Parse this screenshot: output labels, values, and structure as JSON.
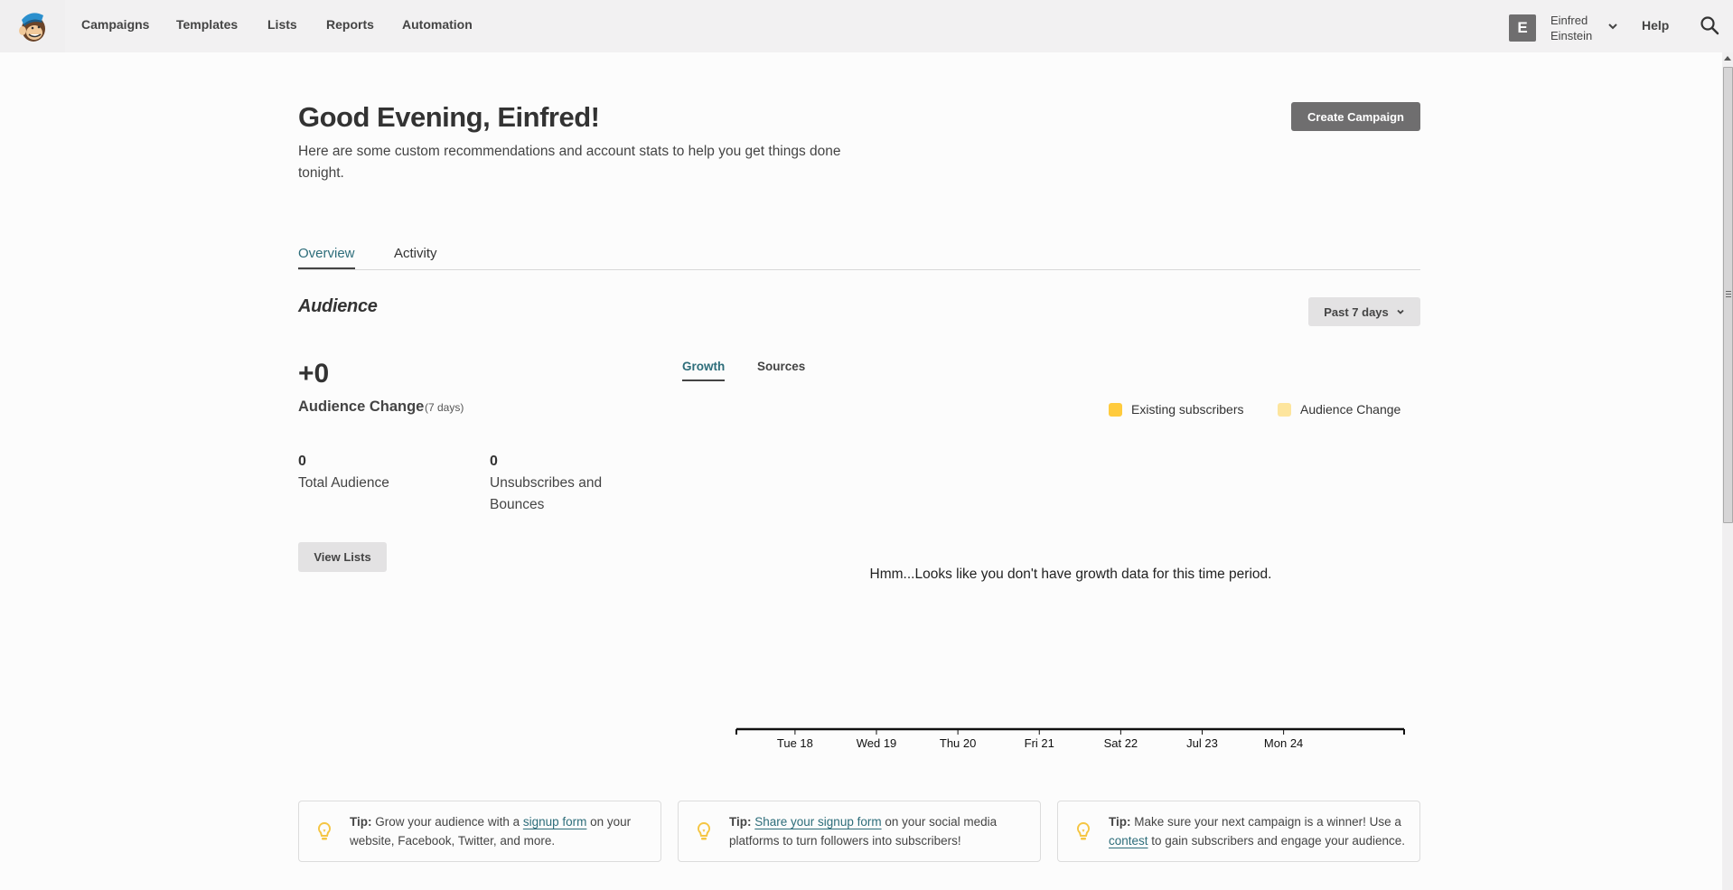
{
  "nav": {
    "items": [
      {
        "label": "Campaigns"
      },
      {
        "label": "Templates"
      },
      {
        "label": "Lists"
      },
      {
        "label": "Reports"
      },
      {
        "label": "Automation"
      }
    ],
    "user": {
      "initial": "E",
      "first_name": "Einfred",
      "last_name": "Einstein"
    },
    "help_label": "Help"
  },
  "header": {
    "greeting": "Good Evening, Einfred!",
    "subtitle": "Here are some custom recommendations and account stats to help you get things done tonight.",
    "create_campaign_label": "Create Campaign"
  },
  "tabs": [
    {
      "label": "Overview",
      "active": true
    },
    {
      "label": "Activity",
      "active": false
    }
  ],
  "audience": {
    "title": "Audience",
    "range_label": "Past 7 days",
    "change_value": "+0",
    "change_label": "Audience Change",
    "change_period": "(7 days)",
    "total_value": "0",
    "total_label": "Total Audience",
    "unsub_value": "0",
    "unsub_label": "Unsubscribes and Bounces",
    "view_lists_label": "View Lists"
  },
  "chart_tabs": [
    {
      "label": "Growth",
      "active": true
    },
    {
      "label": "Sources",
      "active": false
    }
  ],
  "colors": {
    "accent": "#2d6d7a",
    "existing_subscribers": "#ffcb3d",
    "audience_change": "#fde59d",
    "tip_icon": "#f5c542"
  },
  "chart_data": {
    "type": "bar",
    "title": "",
    "xlabel": "",
    "ylabel": "",
    "categories": [
      "Tue 18",
      "Wed 19",
      "Thu 20",
      "Fri 21",
      "Sat 22",
      "Jul 23",
      "Mon 24"
    ],
    "series": [
      {
        "name": "Existing subscribers",
        "values": []
      },
      {
        "name": "Audience Change",
        "values": []
      }
    ],
    "legend": "top-right",
    "grid": false,
    "empty_message": "Hmm...Looks like you don't have growth data for this time period."
  },
  "tips": [
    {
      "prefix": "Tip:",
      "before": " Grow your audience with a ",
      "link": "signup form",
      "after": " on your website, Facebook, Twitter, and more."
    },
    {
      "prefix": "Tip:",
      "before": " ",
      "link": "Share your signup form",
      "after": " on your social media platforms to turn followers into subscribers!"
    },
    {
      "prefix": "Tip:",
      "before": " Make sure your next campaign is a winner! Use a ",
      "link": "contest",
      "after": " to gain subscribers and engage your audience."
    }
  ]
}
